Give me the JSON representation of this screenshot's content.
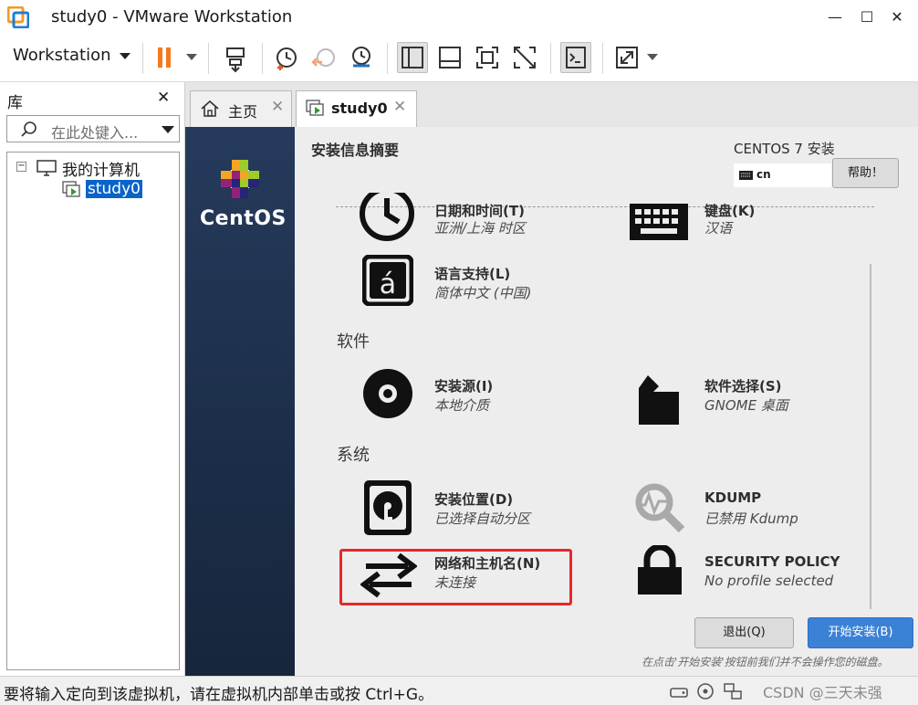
{
  "window": {
    "title": "study0 - VMware Workstation",
    "controls": {
      "minimize": "—",
      "maximize": "☐",
      "close": "✕"
    }
  },
  "toolbar": {
    "workstation_menu": "Workstation",
    "icons": [
      "pause-icon",
      "send-keys-icon",
      "snapshot-icon",
      "revert-snapshot-icon",
      "snapshot-manager-icon",
      "console-view-icon",
      "single-window-icon",
      "fullscreen-icon",
      "unity-icon",
      "terminal-icon",
      "stretch-icon"
    ],
    "pause_color": "#f47920"
  },
  "library": {
    "title": "库",
    "search_placeholder": "在此处键入...",
    "tree": {
      "root_label": "我的计算机",
      "root_expander": "−",
      "vm_label": "study0"
    }
  },
  "tabs": [
    {
      "label": "主页",
      "icon": "home-icon",
      "active": false
    },
    {
      "label": "study0",
      "icon": "vm-icon",
      "active": true
    }
  ],
  "installer": {
    "brand": "CentOS",
    "summary_title": "安装信息摘要",
    "product_title": "CENTOS 7 安装",
    "keyboard_layout": "cn",
    "help_button": "帮助！",
    "sections": {
      "software": "软件",
      "system": "系统"
    },
    "spokes": {
      "datetime": {
        "title": "日期和时间(T)",
        "status": "亚洲/上海 时区"
      },
      "keyboard": {
        "title": "键盘(K)",
        "status": "汉语"
      },
      "language": {
        "title": "语言支持(L)",
        "status": "简体中文 (中国)"
      },
      "source": {
        "title": "安装源(I)",
        "status": "本地介质"
      },
      "software": {
        "title": "软件选择(S)",
        "status": "GNOME 桌面"
      },
      "destination": {
        "title": "安装位置(D)",
        "status": "已选择自动分区"
      },
      "kdump": {
        "title": "KDUMP",
        "status": "已禁用 Kdump"
      },
      "network": {
        "title": "网络和主机名(N)",
        "status": "未连接"
      },
      "security": {
        "title": "SECURITY POLICY",
        "status": "No profile selected"
      }
    },
    "quit_button": "退出(Q)",
    "begin_button": "开始安装(B)",
    "bottom_hint": "在点击'开始安装'按钮前我们并不会操作您的磁盘。",
    "highlight_color": "#e8262a"
  },
  "statusbar": {
    "message": "要将输入定向到该虚拟机，请在虚拟机内部单击或按 Ctrl+G。",
    "watermark": "CSDN @三天未强"
  }
}
